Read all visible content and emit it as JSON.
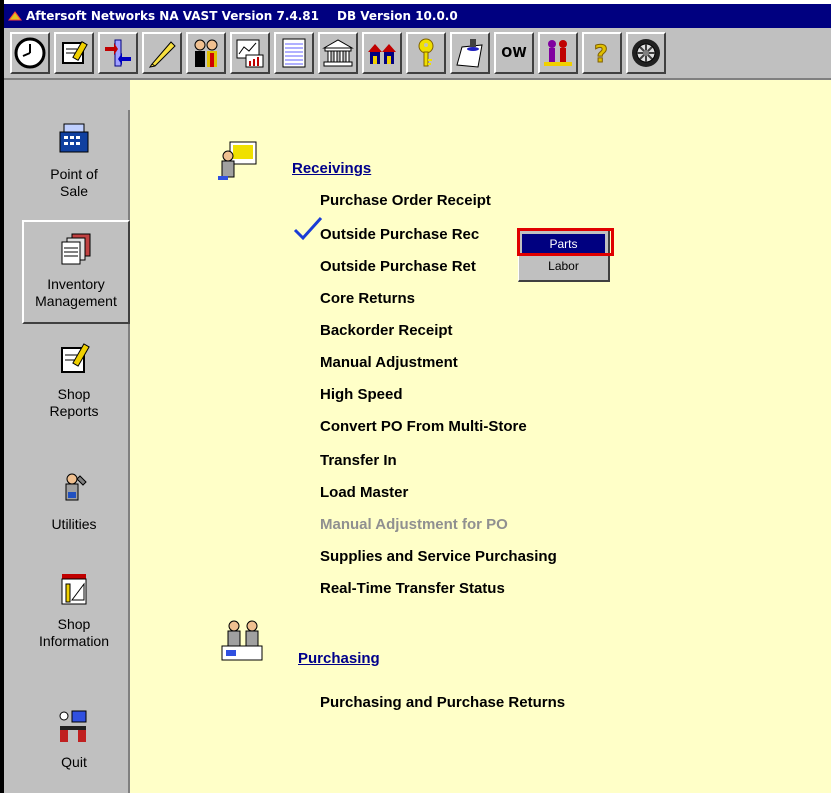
{
  "window": {
    "title_app": "Aftersoft Networks NA VAST Version 7.4.81",
    "title_db": "DB Version 10.0.0"
  },
  "toolbar": {
    "buttons": [
      {
        "icon": "clock-icon"
      },
      {
        "icon": "notepad-pencil-icon"
      },
      {
        "icon": "arrows-transfer-icon"
      },
      {
        "icon": "pencil-icon"
      },
      {
        "icon": "people-group-icon"
      },
      {
        "icon": "report-chart-icon"
      },
      {
        "icon": "ledger-page-icon"
      },
      {
        "icon": "bank-icon"
      },
      {
        "icon": "houses-icon"
      },
      {
        "icon": "key-icon"
      },
      {
        "icon": "document-stamp-icon"
      },
      {
        "icon": "ow-text",
        "label": "OW"
      },
      {
        "icon": "people-chart-icon"
      },
      {
        "icon": "help-question-icon"
      },
      {
        "icon": "tire-wheel-icon"
      }
    ]
  },
  "sidebar": {
    "items": [
      {
        "label_1": "Point of",
        "label_2": "Sale",
        "icon": "cash-register-icon"
      },
      {
        "label_1": "Inventory",
        "label_2": "Management",
        "icon": "inventory-documents-icon",
        "selected": true
      },
      {
        "label_1": "Shop",
        "label_2": "Reports",
        "icon": "notepad-pencil-icon"
      },
      {
        "label_1": "Utilities",
        "label_2": "",
        "icon": "mechanic-tools-icon"
      },
      {
        "label_1": "Shop",
        "label_2": "Information",
        "icon": "calendar-ruler-icon"
      },
      {
        "label_1": "Quit",
        "label_2": "",
        "icon": "exit-door-icon"
      }
    ]
  },
  "receivings": {
    "title": "Receivings",
    "items": [
      {
        "label": "Purchase Order Receipt",
        "enabled": true
      },
      {
        "label": "Outside Purchase Rec",
        "enabled": true,
        "checked": true
      },
      {
        "label": "Outside Purchase Ret",
        "enabled": true
      },
      {
        "label": "Core Returns",
        "enabled": true
      },
      {
        "label": "Backorder Receipt",
        "enabled": true
      },
      {
        "label": "Manual Adjustment",
        "enabled": true
      },
      {
        "label": "High Speed",
        "enabled": true
      },
      {
        "label": "Convert PO From Multi-Store",
        "enabled": true
      },
      {
        "label": "Transfer In",
        "enabled": true
      },
      {
        "label": "Load Master",
        "enabled": true
      },
      {
        "label": "Manual Adjustment for PO",
        "enabled": false
      },
      {
        "label": "Supplies and Service Purchasing",
        "enabled": true
      },
      {
        "label": "Real-Time Transfer Status",
        "enabled": true
      }
    ]
  },
  "purchasing": {
    "title": "Purchasing",
    "items": [
      {
        "label": "Purchasing and Purchase Returns",
        "enabled": true
      }
    ]
  },
  "popup_menu": {
    "items": [
      "Parts",
      "Labor"
    ],
    "highlighted": "Parts"
  },
  "colors": {
    "title_bar": "#000080",
    "content_background": "#ffffc8",
    "section_link": "#00008b",
    "highlight_box": "#e00000",
    "disabled_text": "#909090",
    "checkmark": "#1a3cd6"
  }
}
